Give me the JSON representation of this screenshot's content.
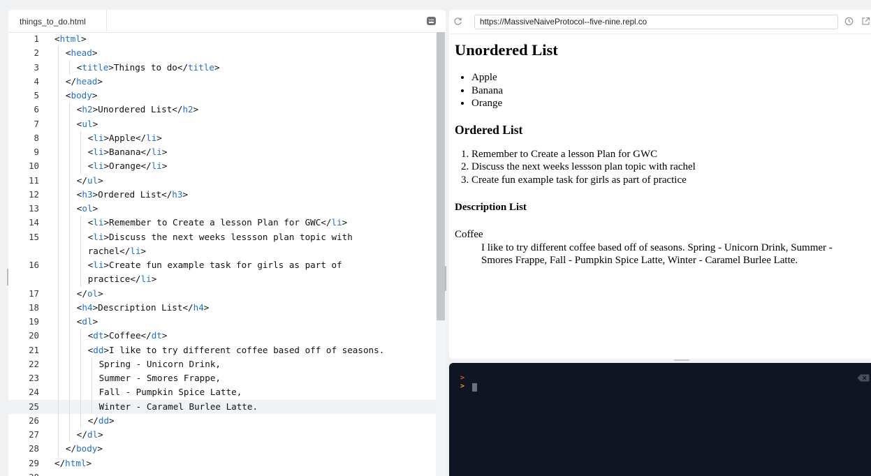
{
  "editor": {
    "tab_label": "things_to_do.html",
    "active_line": 25,
    "lines": [
      {
        "n": "1",
        "indent": 0,
        "guides": 0,
        "code": "<html>"
      },
      {
        "n": "2",
        "indent": 1,
        "guides": 1,
        "code": "<head>"
      },
      {
        "n": "3",
        "indent": 2,
        "guides": 2,
        "code": "<title>Things to do</title>"
      },
      {
        "n": "4",
        "indent": 1,
        "guides": 1,
        "code": "</head>"
      },
      {
        "n": "5",
        "indent": 1,
        "guides": 1,
        "code": "<body>"
      },
      {
        "n": "6",
        "indent": 2,
        "guides": 2,
        "code": "<h2>Unordered List</h2>"
      },
      {
        "n": "7",
        "indent": 2,
        "guides": 2,
        "code": "<ul>"
      },
      {
        "n": "8",
        "indent": 3,
        "guides": 3,
        "code": "<li>Apple</li>"
      },
      {
        "n": "9",
        "indent": 3,
        "guides": 3,
        "code": "<li>Banana</li>"
      },
      {
        "n": "10",
        "indent": 3,
        "guides": 3,
        "code": "<li>Orange</li>"
      },
      {
        "n": "11",
        "indent": 2,
        "guides": 2,
        "code": "</ul>"
      },
      {
        "n": "12",
        "indent": 2,
        "guides": 2,
        "code": "<h3>Ordered List</h3>"
      },
      {
        "n": "13",
        "indent": 2,
        "guides": 2,
        "code": "<ol>"
      },
      {
        "n": "14",
        "indent": 3,
        "guides": 3,
        "code": "<li>Remember to Create a lesson Plan for GWC</li>"
      },
      {
        "n": "15",
        "indent": 3,
        "guides": 3,
        "code": "<li>Discuss the next weeks lessson plan topic with"
      },
      {
        "n": "",
        "indent": 3,
        "guides": 3,
        "code": "rachel</li>"
      },
      {
        "n": "16",
        "indent": 3,
        "guides": 3,
        "code": "<li>Create fun example task for girls as part of"
      },
      {
        "n": "",
        "indent": 3,
        "guides": 3,
        "code": "practice</li>"
      },
      {
        "n": "17",
        "indent": 2,
        "guides": 2,
        "code": "</ol>"
      },
      {
        "n": "18",
        "indent": 2,
        "guides": 2,
        "code": "<h4>Description List</h4>"
      },
      {
        "n": "19",
        "indent": 2,
        "guides": 2,
        "code": "<dl>"
      },
      {
        "n": "20",
        "indent": 3,
        "guides": 3,
        "code": "<dt>Coffee</dt>"
      },
      {
        "n": "21",
        "indent": 3,
        "guides": 3,
        "code": "<dd>I like to try different coffee based off of seasons."
      },
      {
        "n": "22",
        "indent": 4,
        "guides": 4,
        "code": "Spring - Unicorn Drink,"
      },
      {
        "n": "23",
        "indent": 4,
        "guides": 4,
        "code": "Summer - Smores Frappe,"
      },
      {
        "n": "24",
        "indent": 4,
        "guides": 4,
        "code": "Fall - Pumpkin Spice Latte,"
      },
      {
        "n": "25",
        "indent": 4,
        "guides": 4,
        "code": "Winter - Caramel Burlee Latte."
      },
      {
        "n": "26",
        "indent": 3,
        "guides": 3,
        "code": "</dd>"
      },
      {
        "n": "27",
        "indent": 2,
        "guides": 2,
        "code": "</dl>"
      },
      {
        "n": "28",
        "indent": 1,
        "guides": 1,
        "code": "</body>"
      },
      {
        "n": "29",
        "indent": 0,
        "guides": 0,
        "code": "</html>"
      },
      {
        "n": "30",
        "indent": 0,
        "guides": 0,
        "code": ""
      }
    ]
  },
  "preview": {
    "url": "https://MassiveNaiveProtocol--five-nine.repl.co",
    "h2": "Unordered List",
    "ul_items": [
      "Apple",
      "Banana",
      "Orange"
    ],
    "h3": "Ordered List",
    "ol_items": [
      "Remember to Create a lesson Plan for GWC",
      "Discuss the next weeks lessson plan topic with rachel",
      "Create fun example task for girls as part of practice"
    ],
    "h4": "Description List",
    "dt": "Coffee",
    "dd": "I like to try different coffee based off of seasons. Spring - Unicorn Drink, Summer - Smores Frappe, Fall - Pumpkin Spice Latte, Winter - Caramel Burlee Latte."
  },
  "console": {
    "prompt_symbol": ">"
  },
  "colors": {
    "tag": "#1f6fd8",
    "console_bg": "#0f1522",
    "prompt_1": "#d65b30",
    "prompt_2": "#e2a72e"
  },
  "icons": {
    "tab_menu": "menu-icon",
    "reload": "reload-icon",
    "history": "history-icon",
    "open_new_tab": "open-new-tab-icon",
    "clear_console": "clear-console-icon"
  }
}
